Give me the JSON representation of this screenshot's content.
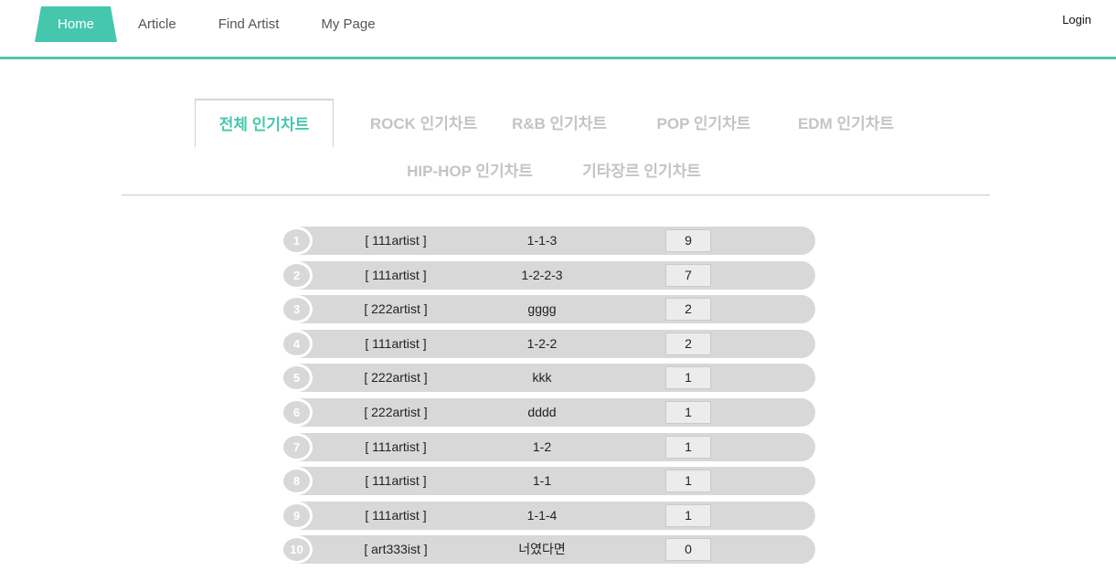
{
  "nav": {
    "items": [
      {
        "label": "Home",
        "active": true
      },
      {
        "label": "Article",
        "active": false
      },
      {
        "label": "Find Artist",
        "active": false
      },
      {
        "label": "My Page",
        "active": false
      }
    ],
    "login_label": "Login"
  },
  "genre_tabs": [
    {
      "label": "전체 인기차트",
      "active": true
    },
    {
      "label": "ROCK 인기차트",
      "active": false
    },
    {
      "label": "R&B 인기차트",
      "active": false
    },
    {
      "label": "POP 인기차트",
      "active": false
    },
    {
      "label": "EDM 인기차트",
      "active": false
    },
    {
      "label": "HIP-HOP 인기차트",
      "active": false
    },
    {
      "label": "기타장르 인기차트",
      "active": false
    }
  ],
  "chart_rows": [
    {
      "rank": "1",
      "artist": "[ 111artist ]",
      "song": "1-1-3",
      "count": "9"
    },
    {
      "rank": "2",
      "artist": "[ 111artist ]",
      "song": "1-2-2-3",
      "count": "7"
    },
    {
      "rank": "3",
      "artist": "[ 222artist ]",
      "song": "gggg",
      "count": "2"
    },
    {
      "rank": "4",
      "artist": "[ 111artist ]",
      "song": "1-2-2",
      "count": "2"
    },
    {
      "rank": "5",
      "artist": "[ 222artist ]",
      "song": "kkk",
      "count": "1"
    },
    {
      "rank": "6",
      "artist": "[ 222artist ]",
      "song": "dddd",
      "count": "1"
    },
    {
      "rank": "7",
      "artist": "[ 111artist ]",
      "song": "1-2",
      "count": "1"
    },
    {
      "rank": "8",
      "artist": "[ 111artist ]",
      "song": "1-1",
      "count": "1"
    },
    {
      "rank": "9",
      "artist": "[ 111artist ]",
      "song": "1-1-4",
      "count": "1"
    },
    {
      "rank": "10",
      "artist": "[ art333ist ]",
      "song": "너였다면",
      "count": "0"
    }
  ],
  "colors": {
    "accent": "#45c7ad",
    "row_bg": "#d8d8d8",
    "tab_inactive": "#c4c4c4"
  }
}
